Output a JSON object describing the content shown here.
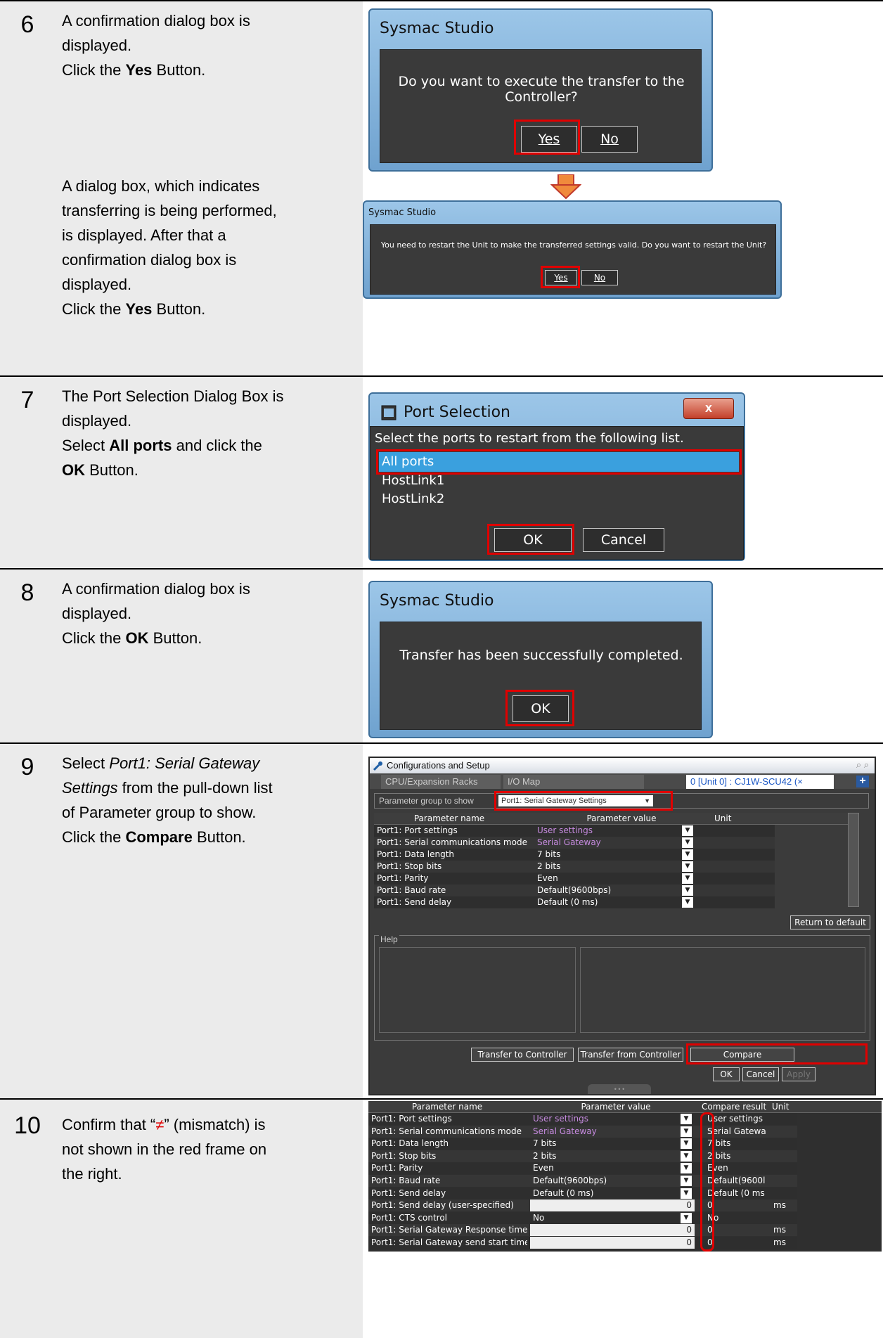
{
  "step6": {
    "num": "6",
    "d1": "A confirmation dialog box is",
    "d2": "displayed.",
    "d3_pre": "Click the ",
    "d3_bold": "Yes",
    "d3_post": " Button.",
    "e1": "A dialog box, which indicates",
    "e2": "transferring is being performed,",
    "e3": "is displayed. After that a",
    "e4": "confirmation dialog box is",
    "e5": "displayed.",
    "e6_pre": "Click the ",
    "e6_bold": "Yes",
    "e6_post": " Button.",
    "dlg1_title": "Sysmac Studio",
    "dlg1_msg": "Do you want to execute the transfer to the Controller?",
    "dlg1_yes": "Yes",
    "dlg1_no": "No",
    "dlg2_title": "Sysmac Studio",
    "dlg2_msg": "You need to restart the Unit to make the transferred settings valid. Do you want to restart the Unit?",
    "dlg2_yes": "Yes",
    "dlg2_no": "No"
  },
  "step7": {
    "num": "7",
    "d1": "The Port Selection Dialog Box is",
    "d2": "displayed.",
    "d3_a": "Select ",
    "d3_b": "All ports",
    "d3_c": " and click the",
    "d4_b": "OK",
    "d4_c": " Button.",
    "title": "Port Selection",
    "prompt": "Select the ports to restart from the following list.",
    "items": [
      "All ports",
      "HostLink1",
      "HostLink2"
    ],
    "ok": "OK",
    "cancel": "Cancel",
    "close": "x"
  },
  "step8": {
    "num": "8",
    "d1": "A confirmation dialog box is",
    "d2": "displayed.",
    "d3_pre": "Click the ",
    "d3_bold": "OK",
    "d3_post": " Button.",
    "title": "Sysmac Studio",
    "msg": "Transfer has been successfully completed.",
    "ok": "OK"
  },
  "step9": {
    "num": "9",
    "d1_pre": "Select ",
    "d1_it": "Port1: Serial Gateway",
    "d2_it": "Settings",
    "d2_post": " from the pull-down list",
    "d3": "of Parameter group to show.",
    "d4_pre": "Click the ",
    "d4_bold": "Compare",
    "d4_post": " Button.",
    "win_title": "Configurations and Setup",
    "tabs": [
      "CPU/Expansion Racks",
      "I/O Map",
      "0 [Unit 0] : CJ1W-SCU42 (×"
    ],
    "group_label": "Parameter group to show",
    "group_value": "Port1: Serial Gateway Settings",
    "headers": [
      "Parameter name",
      "Parameter value",
      "Unit"
    ],
    "rows": [
      [
        "Port1: Port settings",
        "User settings"
      ],
      [
        "Port1: Serial communications mode",
        "Serial Gateway"
      ],
      [
        "Port1: Data length",
        "7 bits"
      ],
      [
        "Port1: Stop bits",
        "2 bits"
      ],
      [
        "Port1: Parity",
        "Even"
      ],
      [
        "Port1: Baud rate",
        "Default(9600bps)"
      ],
      [
        "Port1: Send delay",
        "Default (0 ms)"
      ]
    ],
    "return_default": "Return to default",
    "help": "Help",
    "transfer_to": "Transfer to Controller",
    "transfer_from": "Transfer from Controller",
    "compare": "Compare",
    "ok": "OK",
    "cancel": "Cancel",
    "apply": "Apply",
    "dots": "• • •"
  },
  "step10": {
    "num": "10",
    "d1": "Confirm that “≠” (mismatch) is",
    "d2": "not shown in the red frame on",
    "d3": "the right.",
    "neq": "≠",
    "headers": [
      "Parameter name",
      "Parameter value",
      "Compare results",
      "Unit"
    ],
    "rows": [
      [
        "Port1: Port settings",
        "User settings",
        "",
        "User settings",
        ""
      ],
      [
        "Port1: Serial communications mode",
        "Serial Gateway",
        "",
        "Serial Gatewa",
        ""
      ],
      [
        "Port1: Data length",
        "7 bits",
        "",
        "7 bits",
        ""
      ],
      [
        "Port1: Stop bits",
        "2 bits",
        "",
        "2 bits",
        ""
      ],
      [
        "Port1: Parity",
        "Even",
        "",
        "Even",
        ""
      ],
      [
        "Port1: Baud rate",
        "Default(9600bps)",
        "",
        "Default(9600l",
        ""
      ],
      [
        "Port1: Send delay",
        "Default (0 ms)",
        "",
        "Default (0 ms",
        ""
      ],
      [
        "Port1: Send delay (user-specified)",
        "",
        "0",
        "0",
        "ms"
      ],
      [
        "Port1: CTS control",
        "No",
        "",
        "No",
        ""
      ],
      [
        "Port1: Serial Gateway Response time",
        "",
        "0",
        "0",
        "ms"
      ],
      [
        "Port1: Serial Gateway send start time",
        "",
        "0",
        "0",
        "ms"
      ]
    ]
  }
}
